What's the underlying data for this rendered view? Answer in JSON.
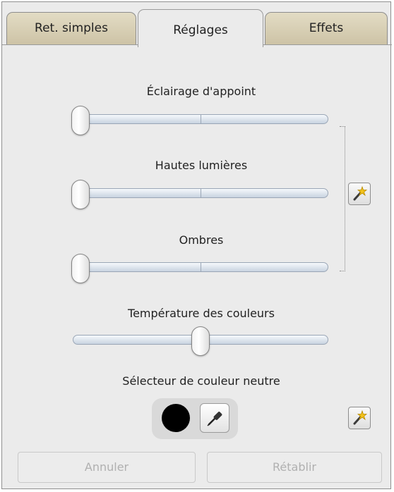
{
  "tabs": [
    {
      "label": "Ret. simples",
      "active": false
    },
    {
      "label": "Réglages",
      "active": true
    },
    {
      "label": "Effets",
      "active": false
    }
  ],
  "sliders": {
    "fill_light": {
      "label": "Éclairage d'appoint",
      "value": 0
    },
    "highlights": {
      "label": "Hautes lumières",
      "value": 0
    },
    "shadows": {
      "label": "Ombres",
      "value": 0
    },
    "temperature": {
      "label": "Température des couleurs",
      "value": 0.5
    }
  },
  "neutral_picker": {
    "label": "Sélecteur de couleur neutre",
    "swatch_color": "#000000"
  },
  "buttons": {
    "cancel": "Annuler",
    "redo": "Rétablir"
  },
  "icons": {
    "auto_levels": "magic-wand-icon",
    "eyedropper": "eyedropper-icon"
  },
  "colors": {
    "panel_bg": "#ebebeb",
    "inactive_tab": "#d8cfb5",
    "track": "#c8d3e0",
    "disabled_text": "#b0b0b0"
  }
}
